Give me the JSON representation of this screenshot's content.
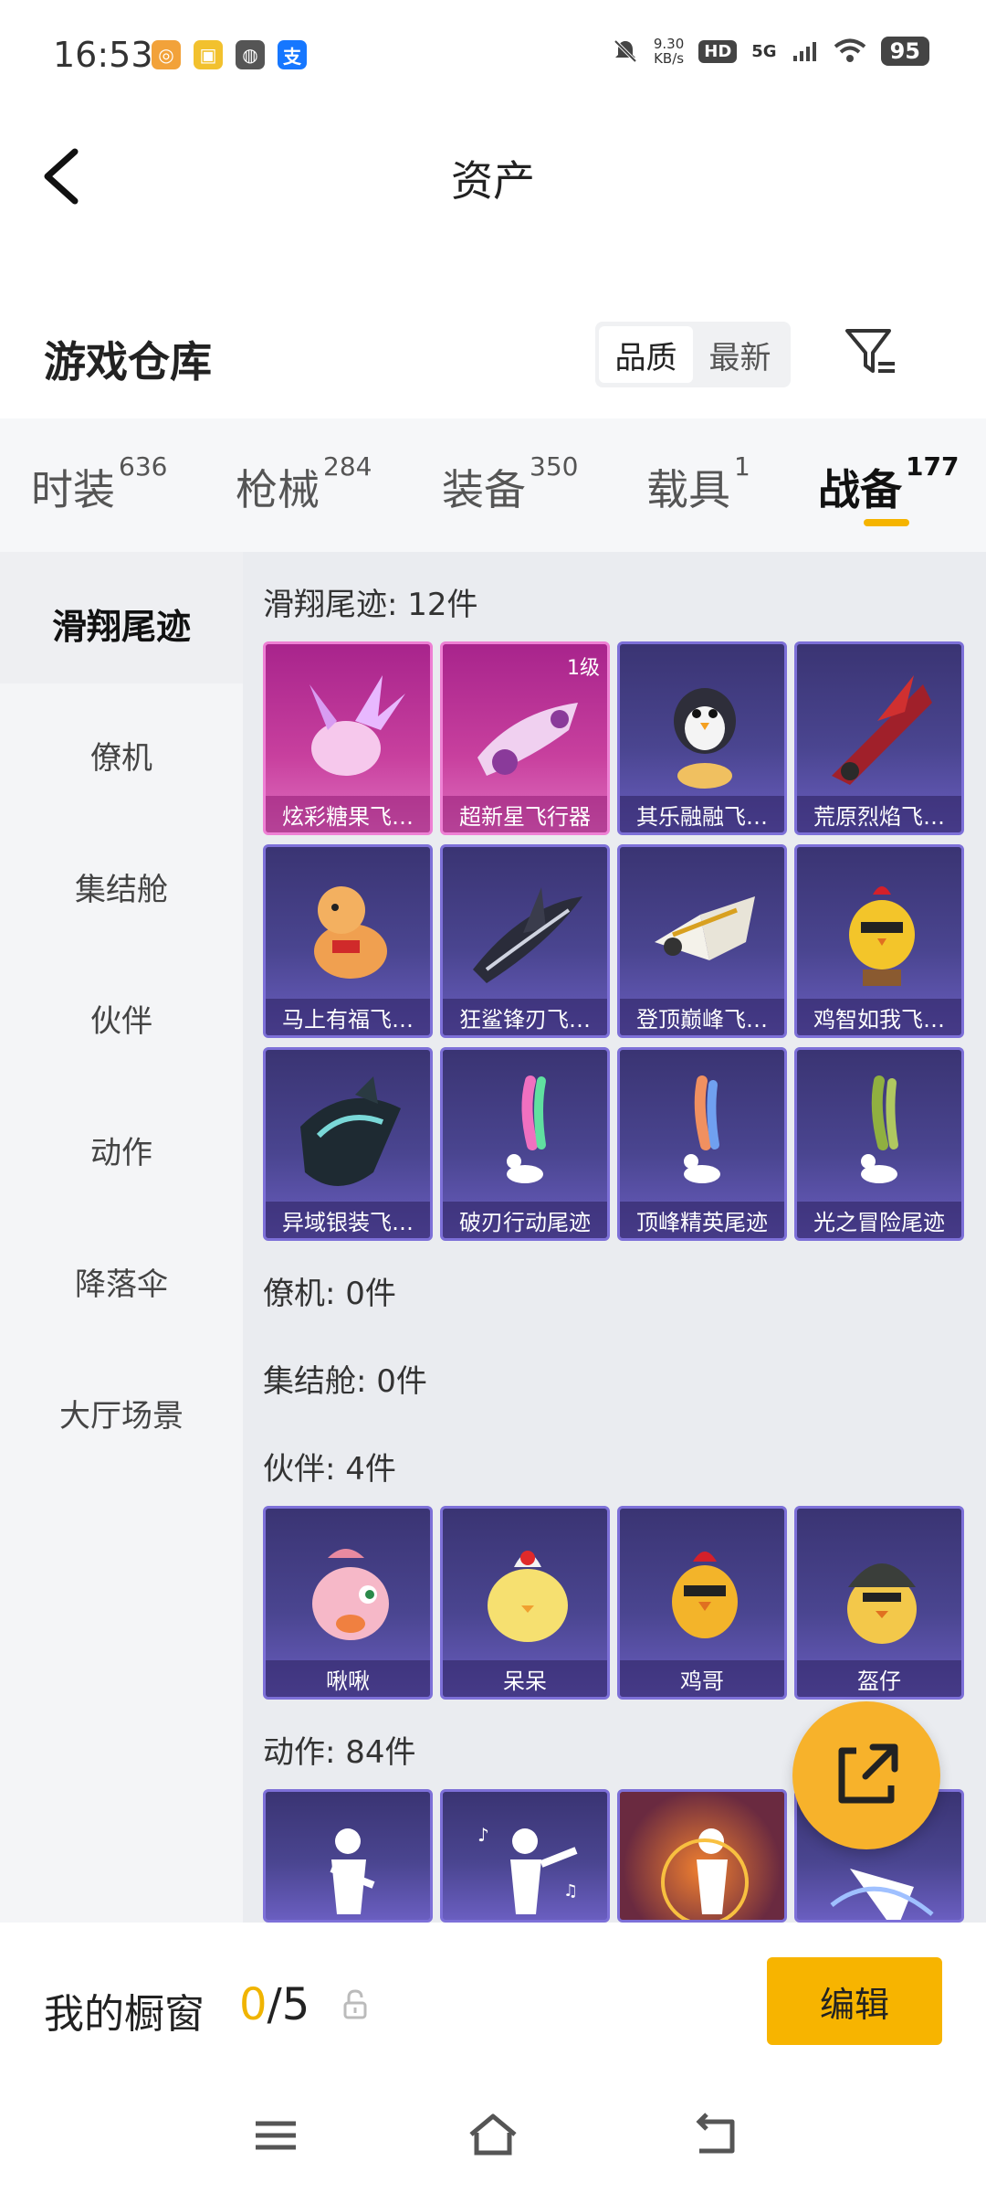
{
  "status_bar": {
    "time": "16:53",
    "apps": [
      {
        "icon": "coin-app-icon",
        "glyph": "◎",
        "color": "#f2a23a"
      },
      {
        "icon": "taobao-app-icon",
        "glyph": "▣",
        "color": "#f2c12e"
      },
      {
        "icon": "swirl-app-icon",
        "glyph": "◍",
        "color": "#555555"
      },
      {
        "icon": "alipay-app-icon",
        "glyph": "支",
        "color": "#1677ff"
      }
    ],
    "net_speed_value": "9.30",
    "net_speed_unit": "KB/s",
    "hd": "HD",
    "signal": "5G",
    "battery": "95"
  },
  "header": {
    "title": "资产"
  },
  "warehouse": {
    "title": "游戏仓库",
    "sort_options": [
      "品质",
      "最新"
    ]
  },
  "tabs": [
    {
      "label": "时装",
      "count": "636"
    },
    {
      "label": "枪械",
      "count": "284"
    },
    {
      "label": "装备",
      "count": "350"
    },
    {
      "label": "载具",
      "count": "1"
    },
    {
      "label": "战备",
      "count": "177"
    }
  ],
  "side_nav": [
    "滑翔尾迹",
    "僚机",
    "集结舱",
    "伙伴",
    "动作",
    "降落伞",
    "大厅场景"
  ],
  "groups": {
    "glide": {
      "header": "滑翔尾迹: 12件",
      "items": [
        {
          "label": "炫彩糖果飞…",
          "level": ""
        },
        {
          "label": "超新星飞行器",
          "level": "1级"
        },
        {
          "label": "其乐融融飞…",
          "level": ""
        },
        {
          "label": "荒原烈焰飞…",
          "level": ""
        },
        {
          "label": "马上有福飞…",
          "level": ""
        },
        {
          "label": "狂鲨锋刃飞…",
          "level": ""
        },
        {
          "label": "登顶巅峰飞…",
          "level": ""
        },
        {
          "label": "鸡智如我飞…",
          "level": ""
        },
        {
          "label": "异域银装飞…",
          "level": ""
        },
        {
          "label": "破刃行动尾迹",
          "level": ""
        },
        {
          "label": "顶峰精英尾迹",
          "level": ""
        },
        {
          "label": "光之冒险尾迹",
          "level": ""
        }
      ]
    },
    "wingman": {
      "header": "僚机: 0件"
    },
    "pod": {
      "header": "集结舱: 0件"
    },
    "partner": {
      "header": "伙伴: 4件",
      "items": [
        {
          "label": "啾啾"
        },
        {
          "label": "呆呆"
        },
        {
          "label": "鸡哥"
        },
        {
          "label": "盔仔"
        }
      ]
    },
    "action": {
      "header": "动作: 84件"
    }
  },
  "showcase": {
    "label": "我的橱窗",
    "current": "0",
    "total": "/5",
    "edit": "编辑"
  },
  "colors": {
    "accent": "#f7b400",
    "card_purple": "#4a4590",
    "card_pink": "#c8409e"
  }
}
